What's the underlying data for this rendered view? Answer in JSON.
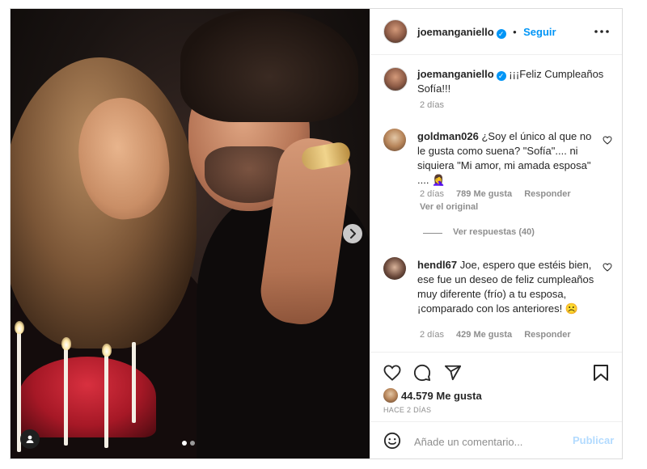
{
  "post": {
    "username": "joemanganiello",
    "separator": "•",
    "follow_label": "Seguir",
    "more_icon": "more-horizontal-icon",
    "verified_icon": "verified-badge-icon"
  },
  "caption": {
    "username": "joemanganiello",
    "text": "¡¡¡Feliz Cumpleaños Sofía!!!",
    "time": "2 días"
  },
  "comments": [
    {
      "username": "goldman026",
      "text": "¿Soy el único al que no le gusta como suena? \"Sofía\".... ni siquiera \"Mi amor, mi amada esposa\" .... 🤦‍♀️",
      "time": "2 días",
      "likes": "789 Me gusta",
      "reply_label": "Responder",
      "see_original": "Ver el original",
      "view_replies": "Ver respuestas (40)"
    },
    {
      "username": "hendl67",
      "text": "Joe, espero que estéis bien, ese fue un deseo de feliz cumpleaños muy diferente (frío) a tu esposa, ¡comparado con los anteriores! ☹️",
      "time": "2 días",
      "likes": "429 Me gusta",
      "reply_label": "Responder"
    }
  ],
  "stats": {
    "likes": "44.579 Me gusta",
    "date": "HACE 2 DÍAS"
  },
  "composer": {
    "placeholder": "Añade un comentario...",
    "publish_label": "Publicar"
  },
  "carousel": {
    "current": 1,
    "total": 2
  },
  "colors": {
    "accent": "#0095f6",
    "muted": "#8e8e8e",
    "text": "#262626",
    "publish_disabled": "#b3dbff"
  }
}
